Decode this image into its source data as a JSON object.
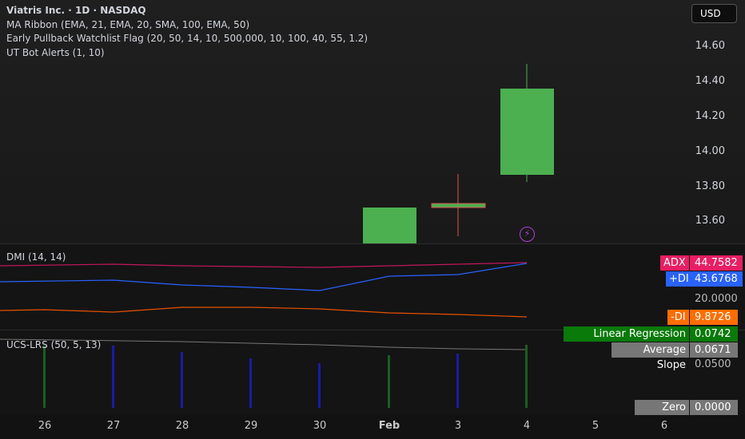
{
  "header": {
    "symbol": "Viatris Inc. · 1D · NASDAQ",
    "indicators": [
      "MA Ribbon (EMA, 21, EMA, 20, SMA, 100, EMA, 50)",
      "Early Pullback Watchlist Flag (20, 50, 14, 10, 500,000, 10, 100, 40, 55, 1.2)",
      "UT Bot Alerts (1, 10)"
    ],
    "currency": "USD"
  },
  "price_axis": [
    "14.60",
    "14.40",
    "14.20",
    "14.00",
    "13.80",
    "13.60"
  ],
  "candles": [
    {
      "date": "Feb 2",
      "open": 13.47,
      "close": 13.68
    },
    {
      "date": "Feb 3",
      "open": 13.69,
      "high": 13.87,
      "low": 13.51,
      "close": 13.7
    },
    {
      "date": "Feb 4",
      "open": 13.86,
      "high": 14.5,
      "low": 13.82,
      "close": 14.36
    }
  ],
  "dmi": {
    "title": "DMI (14, 14)",
    "adx_label": "ADX",
    "adx": "44.7582",
    "pdi_label": "+DI",
    "pdi": "43.6768",
    "level": "20.0000",
    "mdi_label": "-DI",
    "mdi": "9.8726",
    "colors": {
      "adx": "#e91e63",
      "pdi": "#2962ff",
      "mdi": "#ff6d00"
    }
  },
  "lrs": {
    "title": "UCS-LRS (50, 5, 13)",
    "lrs_label": "Linear Regression Slope",
    "lrs": "0.0742",
    "avg_label": "Average Slope",
    "avg": "0.0671",
    "level": "0.0500",
    "zero_label": "Zero Line",
    "zero": "0.0000"
  },
  "time_axis": [
    "26",
    "27",
    "28",
    "29",
    "30",
    "Feb",
    "3",
    "4",
    "5",
    "6"
  ]
}
